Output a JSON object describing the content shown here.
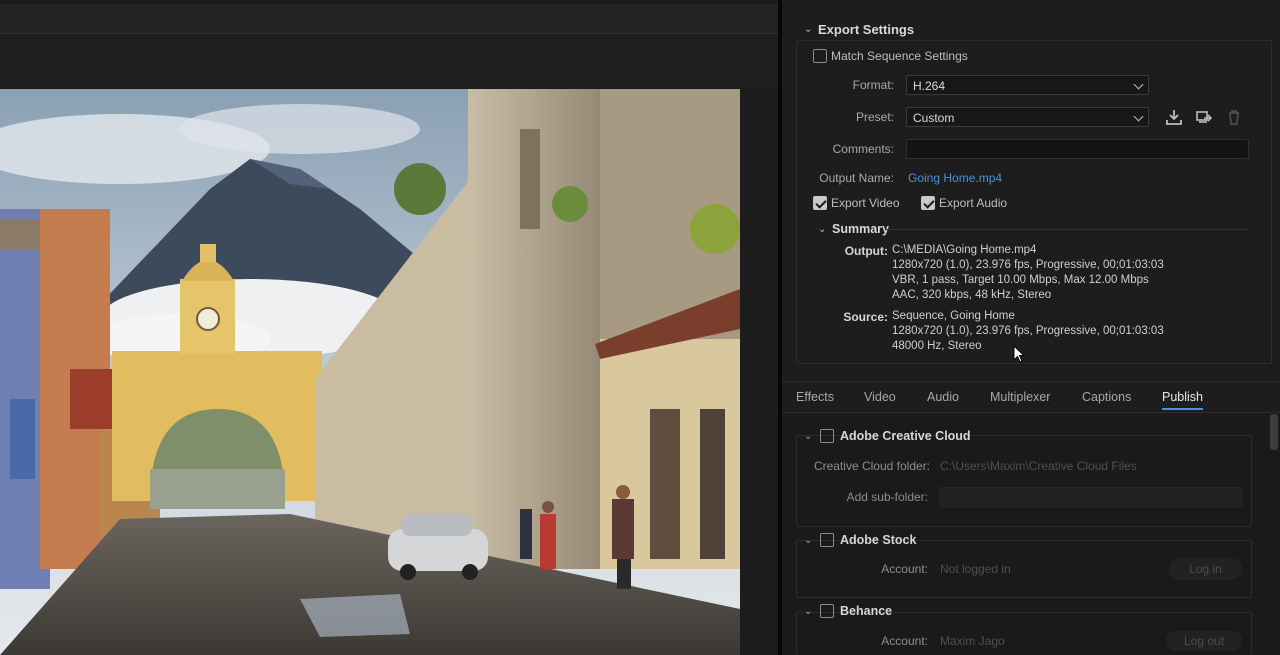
{
  "export_settings": {
    "title": "Export Settings",
    "match_sequence": {
      "label": "Match Sequence Settings",
      "checked": false
    },
    "format": {
      "label": "Format:",
      "value": "H.264"
    },
    "preset": {
      "label": "Preset:",
      "value": "Custom"
    },
    "comments": {
      "label": "Comments:",
      "value": ""
    },
    "output_name": {
      "label": "Output Name:",
      "value": "Going Home.mp4"
    },
    "export_video": {
      "label": "Export Video",
      "checked": true
    },
    "export_audio": {
      "label": "Export Audio",
      "checked": true
    },
    "icons": [
      "save-preset-icon",
      "import-preset-icon",
      "delete-preset-icon"
    ]
  },
  "summary": {
    "title": "Summary",
    "output": {
      "label": "Output:",
      "lines": [
        "C:\\MEDIA\\Going Home.mp4",
        "1280x720 (1.0), 23.976 fps, Progressive, 00;01:03:03",
        "VBR, 1 pass, Target 10.00 Mbps, Max 12.00 Mbps",
        "AAC, 320 kbps, 48 kHz, Stereo"
      ]
    },
    "source": {
      "label": "Source:",
      "lines": [
        "Sequence, Going Home",
        "1280x720 (1.0), 23.976 fps, Progressive, 00;01:03:03",
        "48000 Hz, Stereo"
      ]
    }
  },
  "tabs": [
    {
      "label": "Effects",
      "active": false
    },
    {
      "label": "Video",
      "active": false
    },
    {
      "label": "Audio",
      "active": false
    },
    {
      "label": "Multiplexer",
      "active": false
    },
    {
      "label": "Captions",
      "active": false
    },
    {
      "label": "Publish",
      "active": true
    }
  ],
  "publish": {
    "creative_cloud": {
      "title": "Adobe Creative Cloud",
      "checked": false,
      "folder_label": "Creative Cloud folder:",
      "folder_value": "C:\\Users\\Maxim\\Creative Cloud Files",
      "subfolder_label": "Add sub-folder:",
      "subfolder_value": ""
    },
    "stock": {
      "title": "Adobe Stock",
      "checked": false,
      "account_label": "Account:",
      "account_value": "Not logged in",
      "button": "Log in"
    },
    "behance": {
      "title": "Behance",
      "checked": false,
      "account_label": "Account:",
      "account_value": "Maxim Jago",
      "button": "Log out"
    }
  },
  "colors": {
    "accent": "#4a90e2",
    "panel_bg": "#1d1d1d"
  }
}
